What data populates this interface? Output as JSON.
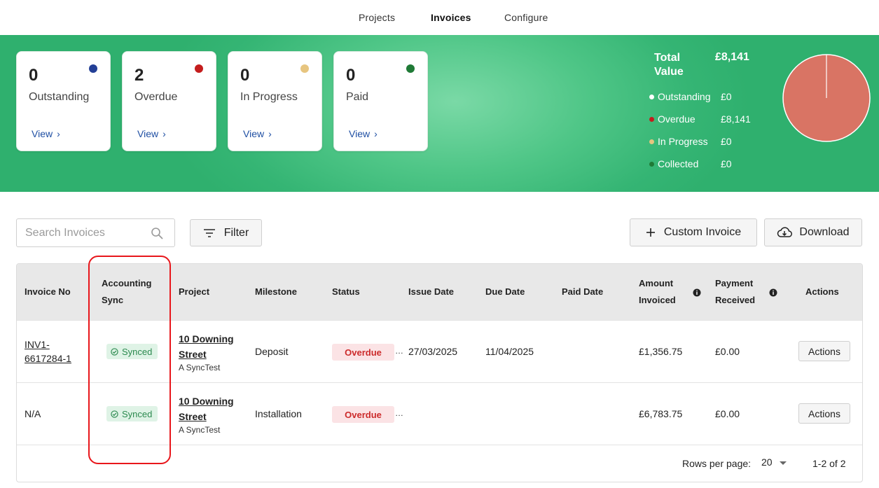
{
  "nav": {
    "items": [
      "Projects",
      "Invoices",
      "Configure"
    ],
    "active": "Invoices"
  },
  "cards": [
    {
      "count": "0",
      "label": "Outstanding",
      "view": "View",
      "color": "#233f96"
    },
    {
      "count": "2",
      "label": "Overdue",
      "view": "View",
      "color": "#c41d1d"
    },
    {
      "count": "0",
      "label": "In Progress",
      "view": "View",
      "color": "#e7c57f"
    },
    {
      "count": "0",
      "label": "Paid",
      "view": "View",
      "color": "#1f7a36"
    }
  ],
  "summary": {
    "title": "Total Value",
    "total": "£8,141",
    "legend": [
      {
        "label": "Outstanding",
        "value": "£0",
        "color": "#ffffff"
      },
      {
        "label": "Overdue",
        "value": "£8,141",
        "color": "#c41d1d"
      },
      {
        "label": "In Progress",
        "value": "£0",
        "color": "#e7c57f"
      },
      {
        "label": "Collected",
        "value": "£0",
        "color": "#1f7a36"
      }
    ],
    "pie_color": "#d97464"
  },
  "toolbar": {
    "search_placeholder": "Search Invoices",
    "filter_label": "Filter",
    "custom_invoice_label": "Custom Invoice",
    "download_label": "Download"
  },
  "table": {
    "headers": {
      "invoice_no": "Invoice No",
      "accounting_sync_1": "Accounting",
      "accounting_sync_2": "Sync",
      "project": "Project",
      "milestone": "Milestone",
      "status": "Status",
      "issue_date": "Issue Date",
      "due_date": "Due Date",
      "paid_date": "Paid Date",
      "amount_invoiced_1": "Amount",
      "amount_invoiced_2": "Invoiced",
      "payment_received_1": "Payment",
      "payment_received_2": "Received",
      "actions": "Actions"
    },
    "rows": [
      {
        "invoice_no_1": "INV1-",
        "invoice_no_2": "6617284-1",
        "sync": "Synced",
        "project_1": "10 Downing",
        "project_2": "Street",
        "project_sub": "A SyncTest",
        "milestone": "Deposit",
        "status": "Overdue",
        "issue_date": "27/03/2025",
        "due_date": "11/04/2025",
        "paid_date": "",
        "amount": "£1,356.75",
        "received": "£0.00",
        "actions": "Actions"
      },
      {
        "invoice_no_1": "N/A",
        "invoice_no_2": "",
        "sync": "Synced",
        "project_1": "10 Downing",
        "project_2": "Street",
        "project_sub": "A SyncTest",
        "milestone": "Installation",
        "status": "Overdue",
        "issue_date": "",
        "due_date": "",
        "paid_date": "",
        "amount": "£6,783.75",
        "received": "£0.00",
        "actions": "Actions"
      }
    ],
    "footer": {
      "rows_label": "Rows per page:",
      "rows_value": "20",
      "range": "1-2 of 2"
    }
  },
  "ellipsis": "…"
}
